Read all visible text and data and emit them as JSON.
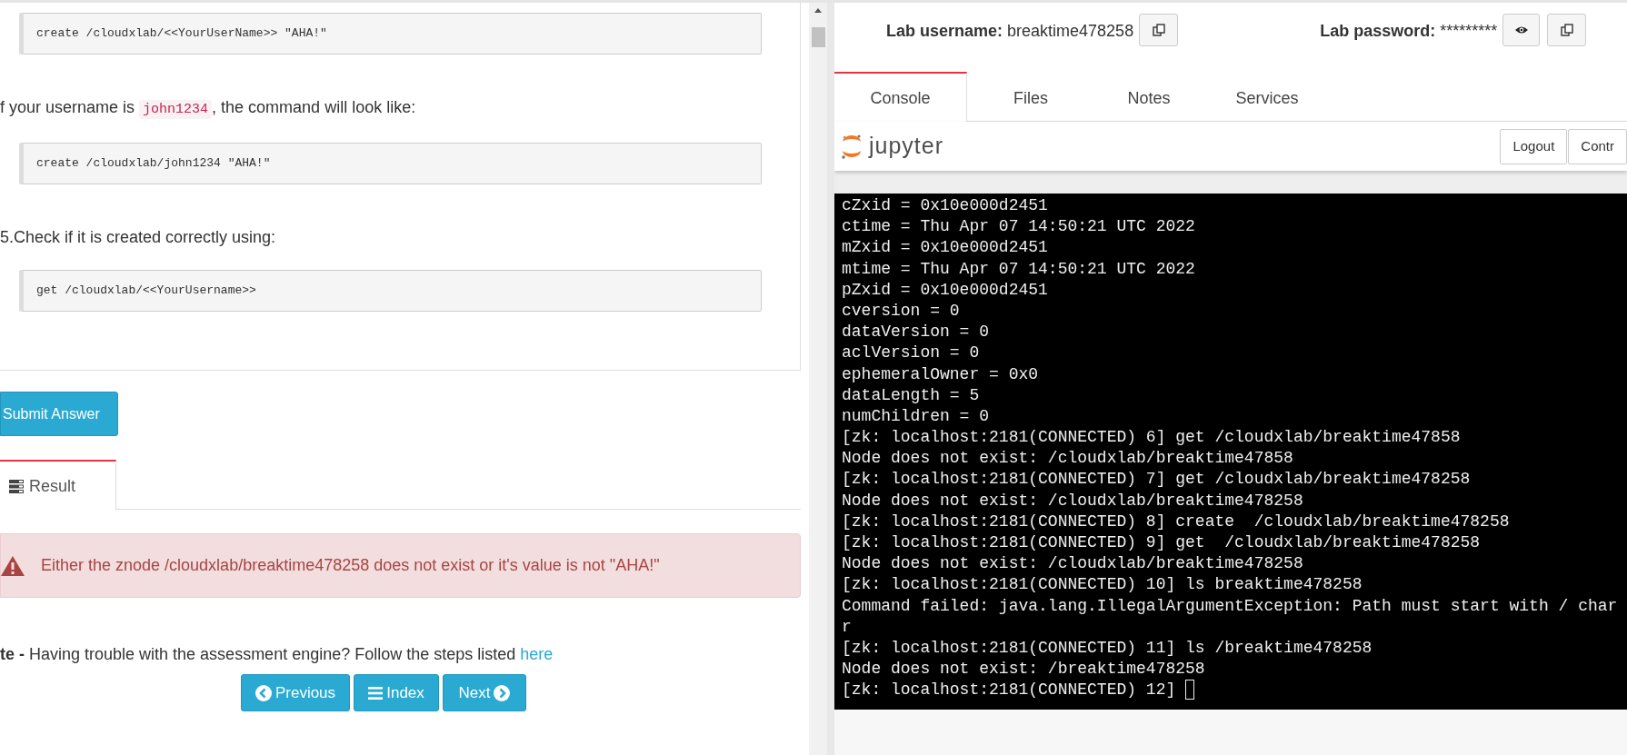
{
  "lesson": {
    "content": [
      {
        "kind": "code",
        "text": "create /cloudxlab/<<YourUserName>> \"AHA!\""
      },
      {
        "kind": "paragraph",
        "parts": [
          {
            "text": "f your username is ",
            "code": false
          },
          {
            "text": "john1234",
            "code": true
          },
          {
            "text": ", the command will look like:",
            "code": false
          }
        ]
      },
      {
        "kind": "code",
        "text": "create /cloudxlab/john1234 \"AHA!\""
      },
      {
        "kind": "paragraph",
        "parts": [
          {
            "text": "5.Check if it is created correctly using:",
            "code": false
          }
        ]
      },
      {
        "kind": "code",
        "text": "get /cloudxlab/<<YourUsername>>"
      }
    ],
    "submit_button": "Submit Answer",
    "result_tab": {
      "label": "Result",
      "selected": true
    },
    "alert": "Either the znode /cloudxlab/breaktime478258 does not exist or it's value is not \"AHA!\"",
    "note": {
      "label": "te -",
      "text": " Having trouble with the assessment engine? Follow the steps listed ",
      "link": "here"
    },
    "nav_buttons": [
      {
        "kind": "previous",
        "label": "Previous"
      },
      {
        "kind": "index",
        "label": "Index"
      },
      {
        "kind": "next",
        "label": "Next"
      }
    ]
  },
  "lab": {
    "username_label": "Lab username:",
    "username": "breaktime478258",
    "password_label": "Lab password:",
    "password": "*********",
    "tabs": [
      {
        "label": "Console",
        "selected": true
      },
      {
        "label": "Files",
        "selected": false
      },
      {
        "label": "Notes",
        "selected": false
      },
      {
        "label": "Services",
        "selected": false
      }
    ],
    "jupyter": {
      "logo": "jupyter",
      "buttons": [
        "Logout",
        "Contr"
      ]
    },
    "terminal_lines": [
      "cZxid = 0x10e000d2451",
      "ctime = Thu Apr 07 14:50:21 UTC 2022",
      "mZxid = 0x10e000d2451",
      "mtime = Thu Apr 07 14:50:21 UTC 2022",
      "pZxid = 0x10e000d2451",
      "cversion = 0",
      "dataVersion = 0",
      "aclVersion = 0",
      "ephemeralOwner = 0x0",
      "dataLength = 5",
      "numChildren = 0",
      "[zk: localhost:2181(CONNECTED) 6] get /cloudxlab/breaktime47858",
      "Node does not exist: /cloudxlab/breaktime47858",
      "[zk: localhost:2181(CONNECTED) 7] get /cloudxlab/breaktime478258",
      "Node does not exist: /cloudxlab/breaktime478258",
      "[zk: localhost:2181(CONNECTED) 8] create  /cloudxlab/breaktime478258",
      "[zk: localhost:2181(CONNECTED) 9] get  /cloudxlab/breaktime478258",
      "Node does not exist: /cloudxlab/breaktime478258",
      "[zk: localhost:2181(CONNECTED) 10] ls breaktime478258",
      "Command failed: java.lang.IllegalArgumentException: Path must start with / char",
      "r",
      "[zk: localhost:2181(CONNECTED) 11] ls /breaktime478258",
      "Node does not exist: /breaktime478258",
      "[zk: localhost:2181(CONNECTED) 12] "
    ]
  }
}
